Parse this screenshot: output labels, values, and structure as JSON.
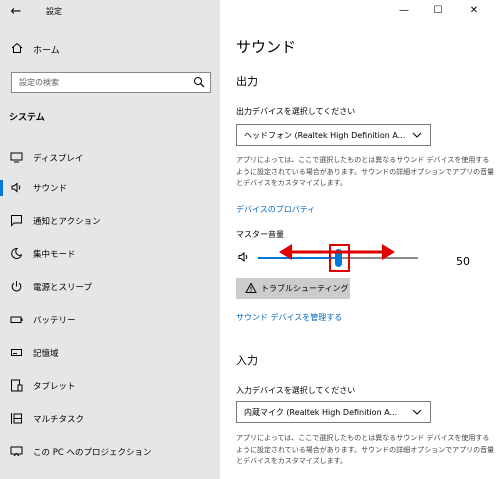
{
  "window": {
    "title": "設定",
    "back_glyph": "←",
    "minimize_glyph": "—",
    "maximize_glyph": "☐",
    "close_glyph": "✕"
  },
  "sidebar": {
    "home_label": "ホーム",
    "search_placeholder": "設定の検索",
    "section_label": "システム",
    "items": [
      {
        "label": "ディスプレイ",
        "icon": "display-icon"
      },
      {
        "label": "サウンド",
        "icon": "speaker-icon",
        "active": true
      },
      {
        "label": "通知とアクション",
        "icon": "notification-icon"
      },
      {
        "label": "集中モード",
        "icon": "moon-icon"
      },
      {
        "label": "電源とスリープ",
        "icon": "power-icon"
      },
      {
        "label": "バッテリー",
        "icon": "battery-icon"
      },
      {
        "label": "記憶域",
        "icon": "storage-icon"
      },
      {
        "label": "タブレット",
        "icon": "tablet-icon"
      },
      {
        "label": "マルチタスク",
        "icon": "multitask-icon"
      },
      {
        "label": "この PC へのプロジェクション",
        "icon": "projection-icon"
      }
    ],
    "accent_color": "#0078d7"
  },
  "main": {
    "title": "サウンド",
    "output": {
      "heading": "出力",
      "select_label": "出力デバイスを選択してください",
      "selected_device": "ヘッドフォン (Realtek High Definition A...",
      "description": "アプリによっては、ここで選択したものとは異なるサウンド デバイスを使用するように設定されている場合があります。サウンドの詳細オプションでアプリの音量とデバイスをカスタマイズします。",
      "properties_link": "デバイスのプロパティ",
      "master_volume_label": "マスター音量",
      "volume": 50,
      "troubleshoot_label": "トラブルシューティング",
      "manage_link": "サウンド デバイスを管理する"
    },
    "input": {
      "heading": "入力",
      "select_label": "入力デバイスを選択してください",
      "selected_device": "内蔵マイク (Realtek High Definition A...",
      "description": "アプリによっては、ここで選択したものとは異なるサウンド デバイスを使用するように設定されている場合があります。サウンドの詳細オプションでアプリの音量とデバイスをカスタマイズします。"
    },
    "link_color": "#0067c0",
    "annotation_color": "#e00000"
  }
}
